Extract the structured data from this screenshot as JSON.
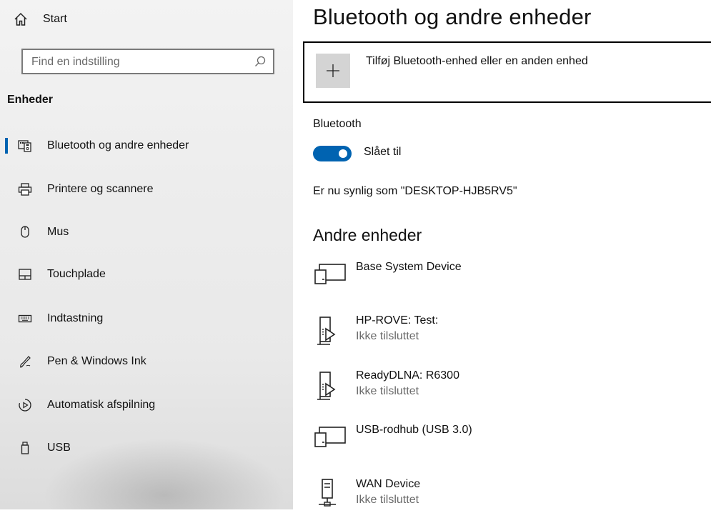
{
  "sidebar": {
    "home_label": "Start",
    "search_placeholder": "Find en indstilling",
    "section_header": "Enheder",
    "items": [
      {
        "label": "Bluetooth og andre enheder",
        "icon": "bluetooth-devices-icon",
        "active": true
      },
      {
        "label": "Printere og scannere",
        "icon": "printer-icon"
      },
      {
        "label": "Mus",
        "icon": "mouse-icon"
      },
      {
        "label": "Touchplade",
        "icon": "touchpad-icon"
      },
      {
        "label": "Indtastning",
        "icon": "keyboard-icon"
      },
      {
        "label": "Pen & Windows Ink",
        "icon": "pen-icon"
      },
      {
        "label": "Automatisk afspilning",
        "icon": "autoplay-icon"
      },
      {
        "label": "USB",
        "icon": "usb-icon"
      }
    ]
  },
  "main": {
    "title": "Bluetooth og andre enheder",
    "add_device_label": "Tilføj Bluetooth-enhed eller en anden enhed",
    "bluetooth_heading": "Bluetooth",
    "bluetooth_toggle_label": "Slået til",
    "bluetooth_on": true,
    "visible_as": "Er nu synlig som \"DESKTOP-HJB5RV5\"",
    "other_devices_heading": "Andre enheder",
    "devices": [
      {
        "name": "Base System Device",
        "status": "",
        "icon": "generic-device-icon"
      },
      {
        "name": "HP-ROVE: Test:",
        "status": "Ikke tilsluttet",
        "icon": "media-device-icon"
      },
      {
        "name": "ReadyDLNA: R6300",
        "status": "Ikke tilsluttet",
        "icon": "media-device-icon"
      },
      {
        "name": "USB-rodhub (USB 3.0)",
        "status": "",
        "icon": "generic-device-icon"
      },
      {
        "name": "WAN Device",
        "status": "Ikke tilsluttet",
        "icon": "network-device-icon"
      }
    ]
  },
  "colors": {
    "accent": "#0063b1",
    "sidebar_bg": "#eeeeee",
    "status_text": "#6b6b6b"
  }
}
